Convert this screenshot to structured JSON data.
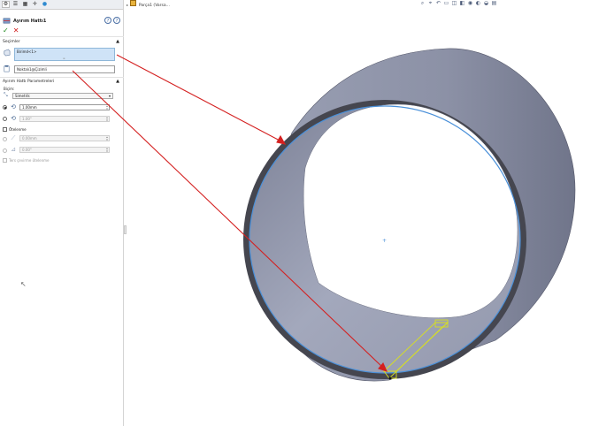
{
  "property_manager": {
    "tabs": [
      {
        "name": "property-manager-tab-icon",
        "glyph": "⚙"
      },
      {
        "name": "feature-tree-tab-icon",
        "glyph": "☰"
      },
      {
        "name": "configuration-tab-icon",
        "glyph": "▦"
      },
      {
        "name": "dimxpert-tab-icon",
        "glyph": "✛"
      },
      {
        "name": "appearance-tab-icon",
        "glyph": "●"
      }
    ],
    "title": "Ayırım Hattı1",
    "help_label": "?",
    "ok_glyph": "✓",
    "cancel_glyph": "✕",
    "selections": {
      "header": "Seçimler",
      "edges_value": "Birimd<1>",
      "face_value": "Noktalı1@Çizimli"
    },
    "params": {
      "header": "Ayırım Hattı Parametreleri",
      "split_label": "Biçim:",
      "split_type": "Simetrik",
      "distance_value": "1.00mm",
      "distance_placeholder": "1.00°",
      "offset_label": "Ötelenme",
      "offset_value_1": "0.00mm",
      "offset_value_2": "0.00°",
      "reverse_label": "Ters çevirme ötelenme"
    }
  },
  "viewport": {
    "tree_label": "Parça1 (Varsa...",
    "toolbar": [
      {
        "name": "zoom-to-fit-icon",
        "glyph": "⌕"
      },
      {
        "name": "zoom-area-icon",
        "glyph": "⌖"
      },
      {
        "name": "previous-view-icon",
        "glyph": "↶"
      },
      {
        "name": "section-view-icon",
        "glyph": "▭"
      },
      {
        "name": "view-orientation-icon",
        "glyph": "◫"
      },
      {
        "name": "display-style-icon",
        "glyph": "◧"
      },
      {
        "name": "hide-show-icon",
        "glyph": "◉"
      },
      {
        "name": "edit-appearance-icon",
        "glyph": "◐"
      },
      {
        "name": "apply-scene-icon",
        "glyph": "◒"
      },
      {
        "name": "view-settings-icon",
        "glyph": "▤"
      }
    ]
  },
  "colors": {
    "cylinder_outer": "#8b8fa3",
    "cylinder_inner": "#9ea3b8",
    "rim_dark": "#3f4048",
    "selection_blue": "#4a90d9",
    "callout_red": "#d42020",
    "highlight_yellow": "#d8e020"
  }
}
